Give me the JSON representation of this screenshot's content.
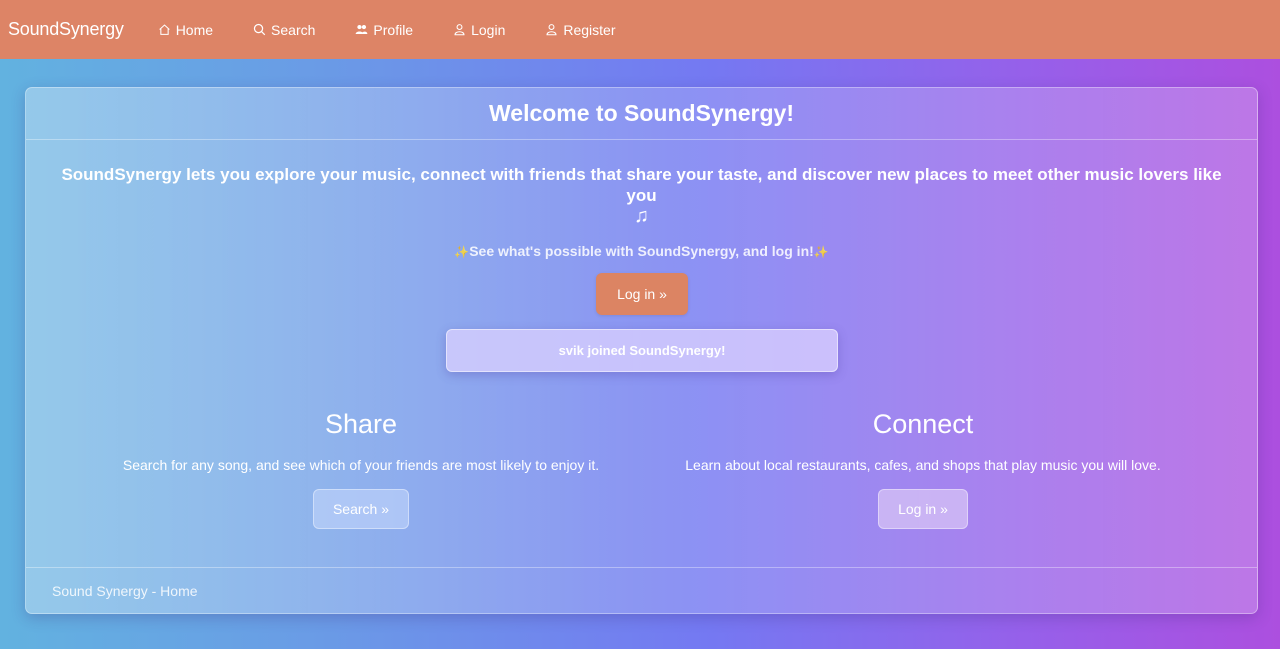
{
  "nav": {
    "brand": "SoundSynergy",
    "items": [
      {
        "label": "Home",
        "icon": "home-icon"
      },
      {
        "label": "Search",
        "icon": "search-icon"
      },
      {
        "label": "Profile",
        "icon": "users-icon"
      },
      {
        "label": "Login",
        "icon": "person-icon"
      },
      {
        "label": "Register",
        "icon": "person-icon"
      }
    ]
  },
  "card": {
    "title": "Welcome to SoundSynergy!",
    "intro": "SoundSynergy lets you explore your music, connect with friends that share your taste, and discover new places to meet other music lovers like you",
    "intro_icon": "♫",
    "cta_text": "See what's possible with SoundSynergy, and log in!",
    "sparkle": "✨",
    "login_button": "Log in »",
    "toast": "svik joined SoundSynergy!",
    "share": {
      "heading": "Share",
      "text": "Search for any song, and see which of your friends are most likely to enjoy it.",
      "button": "Search »"
    },
    "connect": {
      "heading": "Connect",
      "text": "Learn about local restaurants, cafes, and shops that play music you will love.",
      "button": "Log in »"
    },
    "footer": "Sound Synergy - Home"
  },
  "colors": {
    "navbar": "#dd8466",
    "primary_button": "#dc8463"
  }
}
